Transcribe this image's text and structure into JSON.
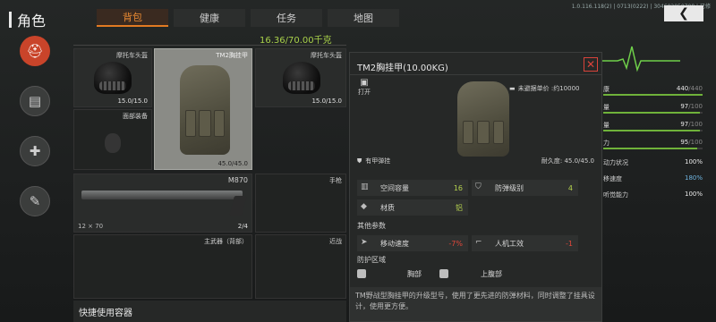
{
  "header": {
    "title": "角色",
    "tabs": [
      {
        "label": "背包",
        "active": true
      },
      {
        "label": "健康",
        "active": false
      },
      {
        "label": "任务",
        "active": false
      },
      {
        "label": "地图",
        "active": false
      }
    ],
    "version_text": "1.0.116.118(2) | 0713(0222) | 304602050708 | 已修",
    "back_icon": "chevron-left-icon"
  },
  "rail": [
    {
      "name": "character-icon",
      "glyph": "●",
      "active": true
    },
    {
      "name": "backpack-icon",
      "glyph": "▤",
      "active": false
    },
    {
      "name": "health-icon",
      "glyph": "✚",
      "active": false
    },
    {
      "name": "tools-icon",
      "glyph": "✎",
      "active": false
    }
  ],
  "inventory": {
    "weight": "16.36/70.00千克",
    "slots": {
      "helmet_left": {
        "label": "摩托车头盔",
        "value": "15.0/15.0"
      },
      "vest": {
        "label": "TM2胸挂甲",
        "value": "45.0/45.0"
      },
      "helmet_right": {
        "label": "摩托车头盔",
        "value": "15.0/15.0"
      },
      "face": {
        "label": "面部装备"
      },
      "shotgun": {
        "label": "M870",
        "ammo": "12 × 70",
        "count": "2/4"
      },
      "pistol": {
        "label": "手枪"
      },
      "primary": {
        "label": "主武器（背部）"
      },
      "melee": {
        "label": "近战"
      }
    },
    "quick_container": "快捷使用容器"
  },
  "popup": {
    "title": "TM2胸挂甲(10.00KG)",
    "close_icon": "close-icon",
    "open_label": "打开",
    "price_label": "未避据单价 :约10000",
    "armor_label": "有甲弹挂",
    "durability": "耐久度: 45.0/45.0",
    "attrs": [
      {
        "key": "空间容量",
        "value": "16",
        "tone": "green"
      },
      {
        "key": "防弹级别",
        "value": "4",
        "tone": "green"
      },
      {
        "key": "材质",
        "value": "铝",
        "tone": "green"
      }
    ],
    "other_params_label": "其他参数",
    "other_params": [
      {
        "key": "移动速度",
        "value": "-7%",
        "tone": "red"
      },
      {
        "key": "人机工效",
        "value": "-1",
        "tone": "red"
      }
    ],
    "zones_label": "防护区域",
    "zones": [
      "胸部",
      "上腹部"
    ],
    "description": "TM野战型胸挂甲的升级型号，使用了更先进的防弹材料，同时调整了挂具设计，使用更方便。"
  },
  "stats": [
    {
      "label": "康",
      "value": "440",
      "max": "/440",
      "fill": 1.0
    },
    {
      "label": "量",
      "value": "97",
      "max": "/100",
      "fill": 0.97
    },
    {
      "label": "量",
      "value": "97",
      "max": "/100",
      "fill": 0.97
    },
    {
      "label": "力",
      "value": "95",
      "max": "/100",
      "fill": 0.95
    },
    {
      "label": "动力状况",
      "value": "100%",
      "max": "",
      "fill": null
    },
    {
      "label": "移速度",
      "value": "180%",
      "max": "",
      "fill": null
    },
    {
      "label": "听觉能力",
      "value": "100%",
      "max": "",
      "fill": null
    }
  ],
  "colors": {
    "accent": "#e27a22",
    "positive": "#b5d24e",
    "negative": "#e0473a"
  }
}
